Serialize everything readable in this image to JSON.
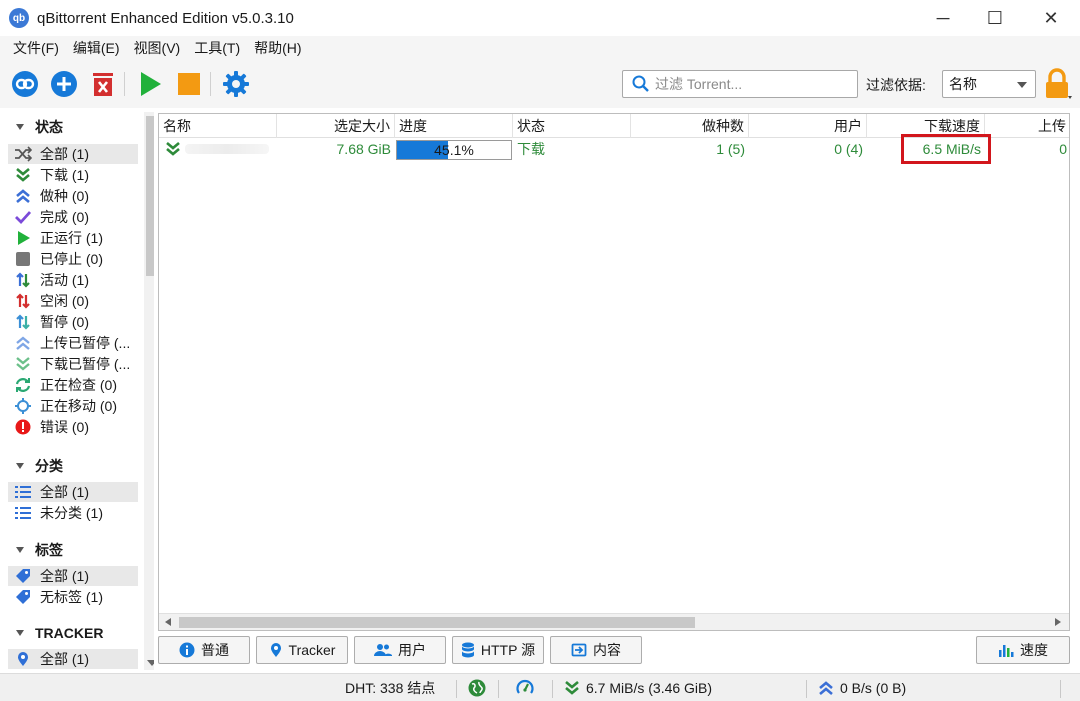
{
  "window": {
    "title": "qBittorrent Enhanced Edition v5.0.3.10",
    "logo_text": "qb",
    "controls": {
      "minimize": "─",
      "maximize": "☐",
      "close": "✕"
    }
  },
  "menu": [
    "文件(F)",
    "编辑(E)",
    "视图(V)",
    "工具(T)",
    "帮助(H)"
  ],
  "toolbar": {
    "search_placeholder": "过滤 Torrent...",
    "filter_label": "过滤依据:",
    "filter_value": "名称"
  },
  "sidebar": {
    "status": {
      "header": "状态",
      "items": [
        {
          "label": "全部 (1)",
          "icon": "shuffle-icon",
          "selected": true
        },
        {
          "label": "下载 (1)",
          "icon": "download-icon"
        },
        {
          "label": "做种 (0)",
          "icon": "seeding-icon"
        },
        {
          "label": "完成 (0)",
          "icon": "check-icon"
        },
        {
          "label": "正运行 (1)",
          "icon": "play-icon"
        },
        {
          "label": "已停止 (0)",
          "icon": "stop-icon"
        },
        {
          "label": "活动 (1)",
          "icon": "active-icon"
        },
        {
          "label": "空闲 (0)",
          "icon": "idle-icon"
        },
        {
          "label": "暂停 (0)",
          "icon": "paused-icon"
        },
        {
          "label": "上传已暂停 (...",
          "icon": "upload-paused-icon"
        },
        {
          "label": "下载已暂停 (...",
          "icon": "download-paused-icon"
        },
        {
          "label": "正在检查 (0)",
          "icon": "checking-icon"
        },
        {
          "label": "正在移动 (0)",
          "icon": "moving-icon"
        },
        {
          "label": "错误 (0)",
          "icon": "error-icon"
        }
      ]
    },
    "categories": {
      "header": "分类",
      "items": [
        {
          "label": "全部 (1)",
          "icon": "list-icon",
          "selected": true
        },
        {
          "label": "未分类 (1)",
          "icon": "list-icon"
        }
      ]
    },
    "tags": {
      "header": "标签",
      "items": [
        {
          "label": "全部 (1)",
          "icon": "tag-icon",
          "selected": true
        },
        {
          "label": "无标签 (1)",
          "icon": "tag-icon"
        }
      ]
    },
    "trackers": {
      "header": "TRACKER",
      "items": [
        {
          "label": "全部 (1)",
          "icon": "location-icon",
          "selected": true
        }
      ]
    }
  },
  "table": {
    "columns": [
      "名称",
      "选定大小",
      "进度",
      "状态",
      "做种数",
      "用户",
      "下载速度",
      "上传"
    ],
    "rows": [
      {
        "name": "",
        "size": "7.68 GiB",
        "progress_text": "45.1%",
        "progress": 0.451,
        "status": "下载",
        "seeds": "1 (5)",
        "peers": "0 (4)",
        "dl_speed": "6.5 MiB/s",
        "ul_speed": "0"
      }
    ]
  },
  "tabs": {
    "general": "普通",
    "tracker": "Tracker",
    "peers": "用户",
    "http": "HTTP 源",
    "content": "内容",
    "speed": "速度"
  },
  "statusbar": {
    "dht": "DHT:  338 结点",
    "download": "6.7 MiB/s (3.46 GiB)",
    "upload": "0 B/s (0 B)"
  },
  "colors": {
    "accent": "#1679d8",
    "green": "#2e8b3a",
    "highlight": "#d2161c",
    "orange": "#f39a12"
  }
}
